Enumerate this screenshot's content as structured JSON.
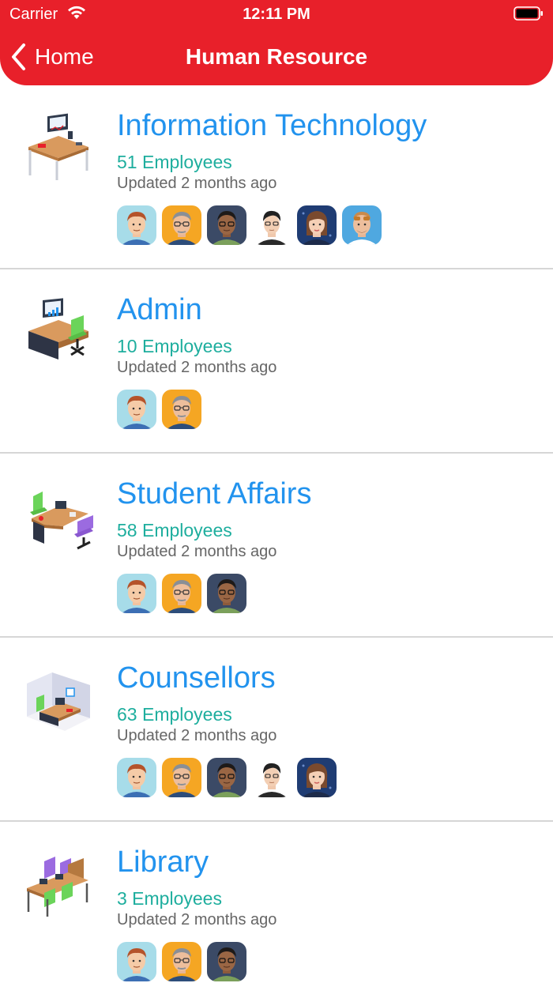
{
  "status_bar": {
    "carrier": "Carrier",
    "time": "12:11 PM"
  },
  "nav": {
    "back_label": "Home",
    "title": "Human Resource"
  },
  "colors": {
    "header": "#E8202A",
    "dept_name": "#2293EE",
    "employee_count": "#1EAE9E"
  },
  "departments": [
    {
      "name": "Information Technology",
      "employees": "51 Employees",
      "updated": "Updated 2 months ago",
      "icon": "desk-workstation-icon",
      "avatars": [
        "redhead-man-avatar",
        "glasses-man-avatar",
        "dark-skin-man-avatar",
        "black-hair-man-avatar",
        "woman-avatar",
        "sunglasses-man-avatar"
      ]
    },
    {
      "name": "Admin",
      "employees": "10 Employees",
      "updated": "Updated 2 months ago",
      "icon": "office-desk-chair-icon",
      "avatars": [
        "redhead-man-avatar",
        "glasses-man-avatar"
      ]
    },
    {
      "name": "Student Affairs",
      "employees": "58 Employees",
      "updated": "Updated 2 months ago",
      "icon": "meeting-desk-icon",
      "avatars": [
        "redhead-man-avatar",
        "glasses-man-avatar",
        "dark-skin-man-avatar"
      ]
    },
    {
      "name": "Counsellors",
      "employees": "63 Employees",
      "updated": "Updated 2 months ago",
      "icon": "cubicle-icon",
      "avatars": [
        "redhead-man-avatar",
        "glasses-man-avatar",
        "dark-skin-man-avatar",
        "black-hair-man-avatar",
        "woman-avatar"
      ]
    },
    {
      "name": "Library",
      "employees": "3 Employees",
      "updated": "Updated 2 months ago",
      "icon": "library-desks-icon",
      "avatars": [
        "redhead-man-avatar",
        "glasses-man-avatar",
        "dark-skin-man-avatar"
      ]
    }
  ]
}
